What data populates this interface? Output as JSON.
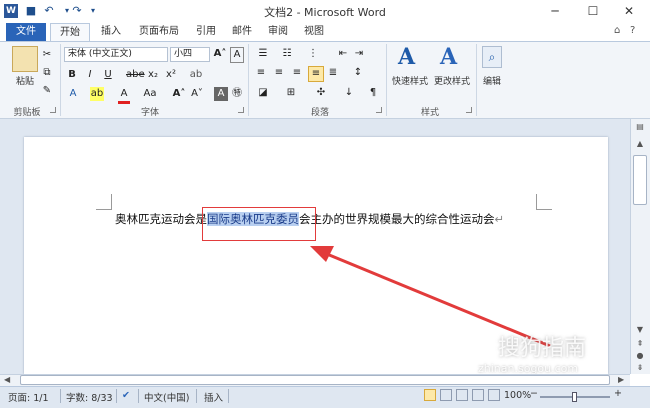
{
  "window": {
    "app_icon": "W",
    "title": "文档2 - Microsoft Word",
    "min": "─",
    "max": "☐",
    "close": "✕"
  },
  "tabs": {
    "file": "文件",
    "items": [
      "开始",
      "插入",
      "页面布局",
      "引用",
      "邮件",
      "审阅",
      "视图"
    ]
  },
  "clipboard": {
    "paste": "粘贴",
    "label": "剪贴板"
  },
  "font": {
    "name": "宋体 (中文正文)",
    "size": "小四",
    "label": "字体",
    "bold": "B",
    "italic": "I",
    "underline": "U",
    "strike": "abe",
    "sub": "x₂",
    "sup": "x²",
    "grow": "A˄",
    "shrink": "A˅",
    "case": "Aa",
    "char_border": "A",
    "phonetic": "wén",
    "highlight": "ab"
  },
  "paragraph": {
    "label": "段落"
  },
  "styles": {
    "quick": "快速样式",
    "change": "更改样式",
    "label": "样式"
  },
  "editing": {
    "edit": "编辑"
  },
  "document": {
    "text_before": "奥林匹克运动会是",
    "text_selected": "国际奥林匹克委员",
    "text_after": "会主办的世界规模最大的综合性运动会",
    "para_mark": "↵"
  },
  "status": {
    "page": "页面: 1/1",
    "words": "字数: 8/33",
    "language": "中文(中国)",
    "insert": "插入",
    "zoom": "100%",
    "zoom_minus": "−",
    "zoom_plus": "+"
  },
  "watermark": {
    "text": "搜狗指南",
    "url": "zhinan.sogou.com"
  },
  "colors": {
    "accent": "#2a64b8",
    "highlight": "#b8cff0",
    "annotation": "#e23b3b"
  }
}
